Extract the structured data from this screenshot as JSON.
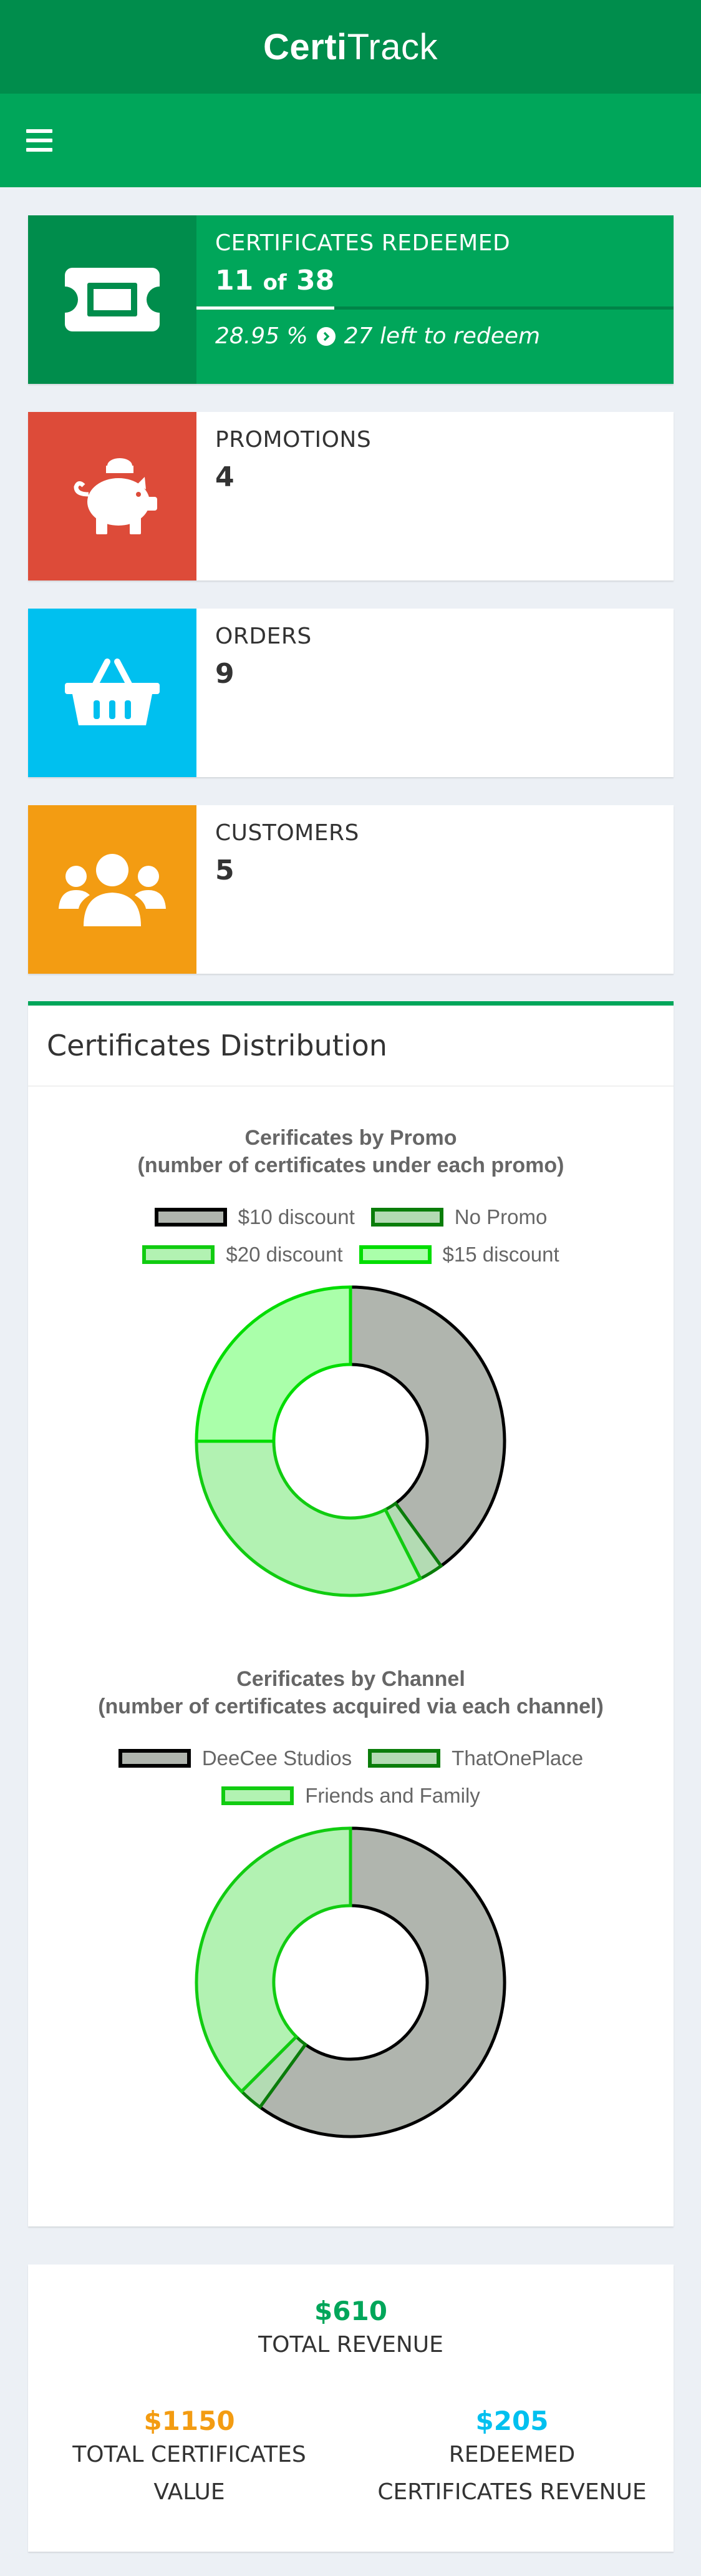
{
  "header": {
    "brand_bold": "Certi",
    "brand_light": "Track"
  },
  "info_boxes": {
    "certificates": {
      "label": "CERTIFICATES REDEEMED",
      "redeemed": "11",
      "of_word": "of",
      "total": "38",
      "percent": "28.95 %",
      "left_text": "27 left to redeem",
      "progress_fraction": 0.2895,
      "color": "#00a65a",
      "icon": "ticket-icon"
    },
    "promotions": {
      "label": "PROMOTIONS",
      "value": "4",
      "color": "#dd4b39",
      "icon": "piggy-bank-icon"
    },
    "orders": {
      "label": "ORDERS",
      "value": "9",
      "color": "#00c0ef",
      "icon": "shopping-basket-icon"
    },
    "customers": {
      "label": "CUSTOMERS",
      "value": "5",
      "color": "#f39c12",
      "icon": "users-icon"
    }
  },
  "panel": {
    "title": "Certificates Distribution"
  },
  "chart_data": [
    {
      "type": "pie",
      "donut": true,
      "title_line1": "Cerificates by Promo",
      "title_line2": "(number of certificates under each promo)",
      "legend": [
        {
          "name": "$10 discount",
          "fill": "#b0b5ae",
          "border": "#000000"
        },
        {
          "name": "No Promo",
          "fill": "#b3dbb3",
          "border": "#0a7d0a"
        },
        {
          "name": "$20 discount",
          "fill": "#b2f2b2",
          "border": "#11cc11"
        },
        {
          "name": "$15 discount",
          "fill": "#aaffaa",
          "border": "#00dd00"
        }
      ],
      "values": [
        16,
        1,
        13,
        10
      ]
    },
    {
      "type": "pie",
      "donut": true,
      "title_line1": "Cerificates by Channel",
      "title_line2": "(number of certificates acquired via each channel)",
      "legend": [
        {
          "name": "DeeCee Studios",
          "fill": "#b0b5ae",
          "border": "#000000"
        },
        {
          "name": "ThatOnePlace",
          "fill": "#b3dbb3",
          "border": "#0a7d0a"
        },
        {
          "name": "Friends and Family",
          "fill": "#b2f2b2",
          "border": "#11cc11"
        }
      ],
      "values": [
        24,
        1,
        15
      ]
    }
  ],
  "stats": {
    "total_revenue": {
      "value": "$610",
      "label": "TOTAL REVENUE",
      "color": "#00a65a"
    },
    "total_cert_value": {
      "value": "$1150",
      "label_line1": "TOTAL CERTIFICATES",
      "label_line2": "VALUE",
      "color": "#f39c12"
    },
    "redeemed_revenue": {
      "value": "$205",
      "label_line1": "REDEEMED",
      "label_line2": "CERTIFICATES REVENUE",
      "color": "#00c0ef"
    }
  }
}
